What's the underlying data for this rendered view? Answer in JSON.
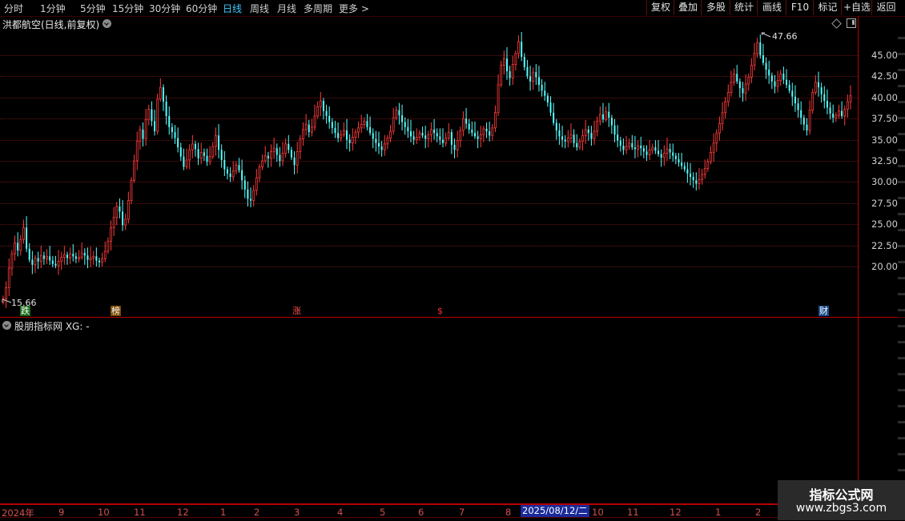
{
  "toolbar": {
    "periods": [
      "分时",
      "1分钟",
      "5分钟",
      "15分钟",
      "30分钟",
      "60分钟",
      "日线",
      "周线",
      "月线",
      "多周期",
      "更多 >"
    ],
    "active_period": "日线",
    "buttons": [
      "复权",
      "叠加",
      "多股",
      "统计",
      "画线",
      "F10",
      "标记",
      "+自选",
      "返回"
    ]
  },
  "stock": {
    "title": "洪都航空(日线,前复权)"
  },
  "indicator": {
    "title": "股朋指标网 XG: -"
  },
  "annotations": {
    "max_label": "47.66",
    "min_label": "15.66",
    "tags": [
      {
        "text": "跌",
        "bg": "#1a6a1a",
        "color": "#ffffff"
      },
      {
        "text": "榜",
        "bg": "#7a4a00",
        "color": "#ffffff"
      },
      {
        "text": "涨",
        "bg": "#000000",
        "color": "#ff5050"
      },
      {
        "text": "$",
        "bg": "#000000",
        "color": "#ff3030"
      },
      {
        "text": "财",
        "bg": "#1a4a8a",
        "color": "#ffffff"
      }
    ]
  },
  "x_axis": {
    "labels": [
      "2024年",
      "9",
      "10",
      "11",
      "12",
      "1",
      "2",
      "3",
      "4",
      "5",
      "6",
      "7",
      "8",
      "10",
      "11",
      "12",
      "1",
      "2"
    ],
    "selected_date": "2025/08/12/二"
  },
  "watermark": {
    "line1": "指标公式网",
    "line2": "www.zbgs3.com"
  },
  "colors": {
    "up": "#ff3c3c",
    "down": "#54ffff",
    "grid": "#6e1414",
    "border": "#b40000"
  },
  "chart_data": {
    "type": "candlestick",
    "y_ticks": [
      "45.00",
      "42.50",
      "40.00",
      "37.50",
      "35.00",
      "32.50",
      "30.00",
      "27.50",
      "25.00",
      "22.50",
      "20.00"
    ],
    "ylim": [
      15,
      49
    ],
    "x_start": "2024-08",
    "x_end": "2026-02",
    "max": 47.66,
    "min": 15.66,
    "closes": [
      16.2,
      17.5,
      19.8,
      21.5,
      22.8,
      21.9,
      23.2,
      24.6,
      22.1,
      20.8,
      20.2,
      21.0,
      20.6,
      21.3,
      20.9,
      21.2,
      20.7,
      20.3,
      20.1,
      20.6,
      21.1,
      21.4,
      21.0,
      21.5,
      21.2,
      20.9,
      21.1,
      21.6,
      21.3,
      20.8,
      21.0,
      21.2,
      20.7,
      20.5,
      20.9,
      21.8,
      23.0,
      24.6,
      25.8,
      27.1,
      26.5,
      24.9,
      25.6,
      27.8,
      30.2,
      32.5,
      34.8,
      36.2,
      35.1,
      37.4,
      38.6,
      37.2,
      36.0,
      39.8,
      41.2,
      39.5,
      37.8,
      36.5,
      35.9,
      35.2,
      34.1,
      33.0,
      31.8,
      32.6,
      33.8,
      34.5,
      33.9,
      32.8,
      33.5,
      33.1,
      32.4,
      33.0,
      34.2,
      35.5,
      33.8,
      32.6,
      31.5,
      31.0,
      30.6,
      31.3,
      32.0,
      31.4,
      30.2,
      29.1,
      28.0,
      27.8,
      29.0,
      30.5,
      31.8,
      32.5,
      33.1,
      32.8,
      33.6,
      34.0,
      33.2,
      32.5,
      33.4,
      34.5,
      33.8,
      32.9,
      32.0,
      33.6,
      35.1,
      36.2,
      36.8,
      35.9,
      36.5,
      37.8,
      38.9,
      39.6,
      38.4,
      37.8,
      37.1,
      36.4,
      35.8,
      35.2,
      35.6,
      36.1,
      35.0,
      34.6,
      35.3,
      35.9,
      36.4,
      36.8,
      37.2,
      36.5,
      35.8,
      35.1,
      34.6,
      34.2,
      33.8,
      34.5,
      35.2,
      36.0,
      37.6,
      38.5,
      37.9,
      37.1,
      36.5,
      36.0,
      35.4,
      35.0,
      35.3,
      35.8,
      35.5,
      35.1,
      35.6,
      36.2,
      35.8,
      35.4,
      35.0,
      34.6,
      35.2,
      35.9,
      34.4,
      33.8,
      34.9,
      36.1,
      37.5,
      36.9,
      36.2,
      35.8,
      35.4,
      35.1,
      35.6,
      36.3,
      36.0,
      35.5,
      36.4,
      38.2,
      41.5,
      43.8,
      44.6,
      43.1,
      42.3,
      43.9,
      45.2,
      46.6,
      44.8,
      43.6,
      42.5,
      41.9,
      43.0,
      42.4,
      41.5,
      40.8,
      40.2,
      39.4,
      38.2,
      37.0,
      36.1,
      35.4,
      35.0,
      34.8,
      35.2,
      35.6,
      34.6,
      34.1,
      34.8,
      35.5,
      36.2,
      35.8,
      35.1,
      36.0,
      37.2,
      38.0,
      37.4,
      38.3,
      37.6,
      36.7,
      35.6,
      34.9,
      34.3,
      33.8,
      34.2,
      34.6,
      34.1,
      33.9,
      34.3,
      34.0,
      33.6,
      33.2,
      33.8,
      34.1,
      33.7,
      33.3,
      32.9,
      33.4,
      33.9,
      33.5,
      33.1,
      32.7,
      32.3,
      31.9,
      31.5,
      31.0,
      30.6,
      30.2,
      29.8,
      30.3,
      30.9,
      31.6,
      32.4,
      33.5,
      34.6,
      35.8,
      36.9,
      38.2,
      39.5,
      40.6,
      41.8,
      42.8,
      41.9,
      41.1,
      40.5,
      41.6,
      42.4,
      43.8,
      45.2,
      46.5,
      45.0,
      44.1,
      43.3,
      42.6,
      41.9,
      41.3,
      42.0,
      42.8,
      42.1,
      41.5,
      40.8,
      40.1,
      39.3,
      38.5,
      37.6,
      36.8,
      36.1,
      38.5,
      40.6,
      41.8,
      41.2,
      40.4,
      39.6,
      38.8,
      38.1,
      37.6,
      37.9,
      38.4,
      37.8,
      38.6,
      39.5,
      40.2
    ]
  }
}
